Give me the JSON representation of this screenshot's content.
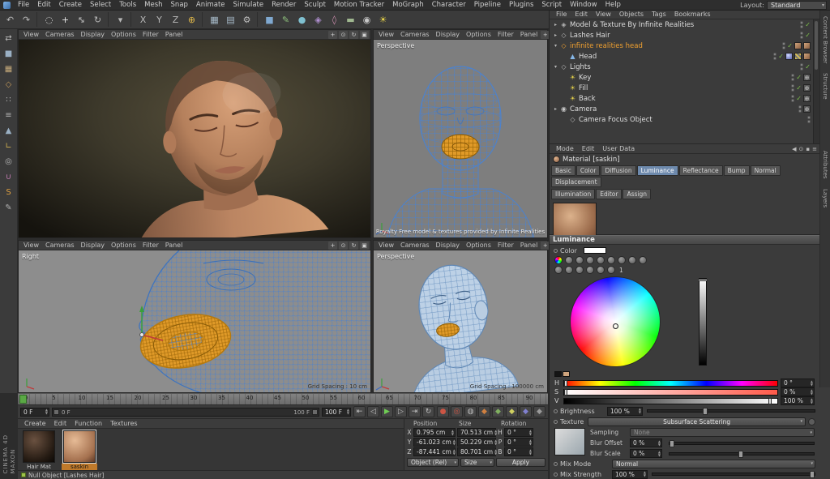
{
  "menubar": {
    "items": [
      "File",
      "Edit",
      "Create",
      "Select",
      "Tools",
      "Mesh",
      "Snap",
      "Animate",
      "Simulate",
      "Render",
      "Sculpt",
      "Motion Tracker",
      "MoGraph",
      "Character",
      "Pipeline",
      "Plugins",
      "Script",
      "Window",
      "Help"
    ],
    "layout_label": "Layout:",
    "layout_value": "Standard"
  },
  "toolbar": {
    "buttons": [
      {
        "name": "undo-icon",
        "glyph": "↶"
      },
      {
        "name": "redo-icon",
        "glyph": "↷"
      },
      {
        "sep": true
      },
      {
        "name": "live-selection-icon",
        "glyph": "◌",
        "color": "#e0e0e0"
      },
      {
        "name": "move-tool-icon",
        "glyph": "+",
        "color": "#e8e8e8"
      },
      {
        "name": "scale-tool-icon",
        "glyph": "↔",
        "rot": true
      },
      {
        "name": "rotate-tool-icon",
        "glyph": "↻"
      },
      {
        "sep": true
      },
      {
        "name": "last-tool-icon",
        "glyph": "▾"
      },
      {
        "sep": true
      },
      {
        "name": "lock-x-axis-icon",
        "glyph": "X"
      },
      {
        "name": "lock-y-axis-icon",
        "glyph": "Y"
      },
      {
        "name": "lock-z-axis-icon",
        "glyph": "Z"
      },
      {
        "name": "coord-system-icon",
        "glyph": "⊕",
        "color": "#e0b84a"
      },
      {
        "sep": true
      },
      {
        "name": "render-view-icon",
        "glyph": "▦",
        "color": "#a8bccb"
      },
      {
        "name": "render-picture-viewer-icon",
        "glyph": "▤",
        "color": "#a8bccb"
      },
      {
        "name": "render-settings-icon",
        "glyph": "⚙",
        "color": "#bdbdbd"
      },
      {
        "sep": true
      },
      {
        "name": "add-primitive-cube-icon",
        "glyph": "■",
        "color": "#7fa8d0"
      },
      {
        "name": "add-spline-icon",
        "glyph": "✎",
        "color": "#8ec07c"
      },
      {
        "name": "subdivision-surface-icon",
        "glyph": "●",
        "color": "#7fc0d0"
      },
      {
        "name": "mograph-icon",
        "glyph": "◈",
        "color": "#b08fd0"
      },
      {
        "name": "deformer-icon",
        "glyph": "◊",
        "color": "#d08fb0"
      },
      {
        "name": "floor-icon",
        "glyph": "▬",
        "color": "#a0b890"
      },
      {
        "name": "scene-camera-icon",
        "glyph": "◉",
        "color": "#c8c8c8"
      },
      {
        "name": "scene-light-icon",
        "glyph": "☀",
        "color": "#e8d44a"
      }
    ]
  },
  "palette": [
    {
      "name": "make-editable-icon",
      "glyph": "⇄"
    },
    {
      "name": "model-mode-icon",
      "glyph": "■",
      "color": "#9ab0c4"
    },
    {
      "name": "texture-mode-icon",
      "glyph": "▦",
      "color": "#c4a97a"
    },
    {
      "name": "workplane-mode-icon",
      "glyph": "◇",
      "color": "#c49a5a"
    },
    {
      "name": "points-mode-icon",
      "glyph": "∷"
    },
    {
      "name": "edges-mode-icon",
      "glyph": "≡"
    },
    {
      "name": "polygons-mode-icon",
      "glyph": "▲",
      "color": "#9ab0c4"
    },
    {
      "name": "enable-axis-icon",
      "glyph": "∟",
      "color": "#d0b050"
    },
    {
      "name": "viewport-filter-icon",
      "glyph": "◎"
    },
    {
      "name": "snap-icon",
      "glyph": "∪",
      "color": "#c07ab0"
    },
    {
      "name": "sculpt-icon",
      "glyph": "S",
      "color": "#e0a040"
    },
    {
      "name": "paint-icon",
      "glyph": "✎",
      "color": "#b0b0b0"
    }
  ],
  "viewports": {
    "menu": [
      "View",
      "Cameras",
      "Display",
      "Options",
      "Filter",
      "Panel"
    ],
    "nav_icons": [
      {
        "name": "pan-view-icon",
        "glyph": "+"
      },
      {
        "name": "zoom-view-icon",
        "glyph": "⊙"
      },
      {
        "name": "rotate-view-icon",
        "glyph": "↻"
      },
      {
        "name": "toggle-view-icon",
        "glyph": "▣"
      }
    ],
    "top_right": {
      "label": "Perspective",
      "credit": "Royalty Free model & textures provided by Infinite Realities"
    },
    "bottom_left": {
      "label": "Right",
      "grid": "Grid Spacing : 10 cm"
    },
    "bottom_right": {
      "label": "Perspective",
      "grid": "Grid Spacing : 100000 cm"
    }
  },
  "object_manager": {
    "menu": [
      "File",
      "Edit",
      "View",
      "Objects",
      "Tags",
      "Bookmarks"
    ],
    "check_glyph": "✓",
    "icon_glyphs": {
      "scene": "◈",
      "null": "◇",
      "polygon": "▲",
      "light": "☀",
      "camera": "◉"
    },
    "icon_colors": {
      "scene": "#b5b5b5",
      "null": "#b5b5b5",
      "polygon": "#86b7e8",
      "light": "#e8d44a",
      "camera": "#c8c8c8"
    },
    "tag_glyphs": {
      "target": "⊕"
    },
    "items": [
      {
        "label": "Model & Texture By Infinite Realities",
        "icon": "scene",
        "exp": "closed",
        "depth": 0,
        "check": true,
        "tags": []
      },
      {
        "label": "Lashes Hair",
        "icon": "null",
        "exp": "closed",
        "depth": 0,
        "check": true,
        "tags": []
      },
      {
        "label": "infinite realities head",
        "icon": "null",
        "exp": "open",
        "depth": 0,
        "check": true,
        "selected": true,
        "tags": [
          "texture",
          "texture"
        ]
      },
      {
        "label": "Head",
        "icon": "polygon",
        "exp": "none",
        "depth": 1,
        "check": true,
        "tags": [
          "phong",
          "uv",
          "texture"
        ]
      },
      {
        "label": "Lights",
        "icon": "null",
        "exp": "open",
        "depth": 0,
        "check": true,
        "tags": []
      },
      {
        "label": "Key",
        "icon": "light",
        "exp": "none",
        "depth": 1,
        "check": true,
        "tags": [
          "target"
        ]
      },
      {
        "label": "Fill",
        "icon": "light",
        "exp": "none",
        "depth": 1,
        "check": true,
        "tags": [
          "target"
        ]
      },
      {
        "label": "Back",
        "icon": "light",
        "exp": "none",
        "depth": 1,
        "check": true,
        "tags": [
          "target"
        ]
      },
      {
        "label": "Camera",
        "icon": "camera",
        "exp": "closed",
        "depth": 0,
        "check": false,
        "tags": [
          "target"
        ]
      },
      {
        "label": "Camera Focus Object",
        "icon": "null",
        "exp": "none",
        "depth": 1,
        "check": false,
        "tags": []
      }
    ]
  },
  "attribute_manager": {
    "menu": [
      "Mode",
      "Edit",
      "User Data"
    ],
    "icons": [
      {
        "name": "nav-back-icon",
        "glyph": "◀"
      },
      {
        "name": "pin-icon",
        "glyph": "⊙"
      },
      {
        "name": "lock-icon",
        "glyph": "▪"
      },
      {
        "name": "panel-menu-icon",
        "glyph": "≡"
      }
    ],
    "title": "Material [saskin]",
    "tabs": [
      "Basic",
      "Color",
      "Diffusion",
      "Luminance",
      "Reflectance",
      "Bump",
      "Normal",
      "Displacement"
    ],
    "active_tab": "Luminance",
    "tabs2": [
      "Illumination",
      "Editor",
      "Assign"
    ]
  },
  "luminance": {
    "title": "Luminance",
    "color_label": "Color",
    "count": "1",
    "picker_rows": [
      [
        "wheel",
        "spectrum",
        "image",
        "swatches",
        "mixer",
        "rgb",
        "hsv",
        "kelvin",
        "compare"
      ],
      [
        "eyedropper",
        "hex",
        "presets",
        "gradient",
        "screen",
        "range"
      ]
    ],
    "sliders": [
      {
        "label": "H",
        "value": "0 °",
        "grad": "h",
        "pos": "0%"
      },
      {
        "label": "S",
        "value": "0 %",
        "grad": "s",
        "pos": "0%"
      },
      {
        "label": "V",
        "value": "100 %",
        "grad": "v",
        "pos": "96%"
      }
    ],
    "brightness": {
      "label": "Brightness",
      "value": "100 %"
    },
    "texture": {
      "label": "Texture",
      "value": "Subsurface Scattering"
    },
    "sampling": {
      "label": "Sampling",
      "value": "None"
    },
    "blur_offset": {
      "label": "Blur Offset",
      "value": "0 %"
    },
    "blur_scale": {
      "label": "Blur Scale",
      "value": "0 %"
    },
    "mix_mode": {
      "label": "Mix Mode",
      "value": "Normal"
    },
    "mix_strength": {
      "label": "Mix Strength",
      "value": "100 %"
    }
  },
  "timeline": {
    "ticks": [
      "0",
      "5",
      "10",
      "15",
      "20",
      "25",
      "30",
      "35",
      "40",
      "45",
      "50",
      "55",
      "60",
      "65",
      "70",
      "75",
      "80",
      "85",
      "90"
    ],
    "current": "0 F",
    "range_start": "0 F",
    "range_end": "100 F",
    "end": "100 F"
  },
  "transport": {
    "buttons": [
      {
        "name": "goto-start-button",
        "glyph": "⇤"
      },
      {
        "name": "prev-frame-button",
        "glyph": "◁"
      },
      {
        "name": "play-button",
        "glyph": "▶",
        "color": "#6fce54"
      },
      {
        "name": "next-frame-button",
        "glyph": "▷"
      },
      {
        "name": "goto-end-button",
        "glyph": "⇥"
      },
      {
        "name": "loop-button",
        "glyph": "↻"
      }
    ],
    "record": [
      {
        "name": "record-keyframe-icon",
        "glyph": "●",
        "color": "#cc5544"
      },
      {
        "name": "autokeying-icon",
        "glyph": "◎",
        "color": "#cc5544"
      },
      {
        "name": "keyframe-selection-icon",
        "glyph": "◍",
        "color": "#bdbdbd"
      },
      {
        "name": "record-position-icon",
        "glyph": "◆",
        "color": "#d08040"
      },
      {
        "name": "record-scale-icon",
        "glyph": "◆",
        "color": "#80b060"
      },
      {
        "name": "record-rotation-icon",
        "glyph": "◆",
        "color": "#d0d060"
      },
      {
        "name": "record-parameter-icon",
        "glyph": "◆",
        "color": "#8080d0"
      },
      {
        "name": "record-pla-icon",
        "glyph": "◆",
        "color": "#9a9a9a"
      }
    ]
  },
  "materials_panel": {
    "menu": [
      "Create",
      "Edit",
      "Function",
      "Textures"
    ],
    "items": [
      {
        "label": "Hair Mat",
        "cls": "mat-hair",
        "selected": false
      },
      {
        "label": "saskin",
        "cls": "mat-skin",
        "selected": true
      }
    ]
  },
  "coordinates": {
    "headers": [
      "Position",
      "Size",
      "Rotation"
    ],
    "rows": [
      {
        "axis": "X",
        "pos": "0.795 cm",
        "size": "70.513 cm",
        "rot_label": "H",
        "rot": "0 °"
      },
      {
        "axis": "Y",
        "pos": "-61.023 cm",
        "size": "50.229 cm",
        "rot_label": "P",
        "rot": "0 °"
      },
      {
        "axis": "Z",
        "pos": "-87.441 cm",
        "size": "80.701 cm",
        "rot_label": "B",
        "rot": "0 °"
      }
    ],
    "mode": "Object (Rel)",
    "size_mode": "Size",
    "apply": "Apply"
  },
  "statusbar": {
    "text": "Null Object [Lashes Hair]"
  },
  "side_tabs": {
    "top": [
      "Content Browser",
      "Structure"
    ],
    "mid": [
      "Attributes",
      "Layers"
    ]
  },
  "brand": {
    "line1": "MAXON",
    "line2": "CINEMA 4D"
  },
  "colors": {
    "selection_orange": "#f0a030",
    "wireframe_blue": "#4d82cc",
    "active_tab_blue": "#6d89ac",
    "play_green": "#6fce54"
  }
}
